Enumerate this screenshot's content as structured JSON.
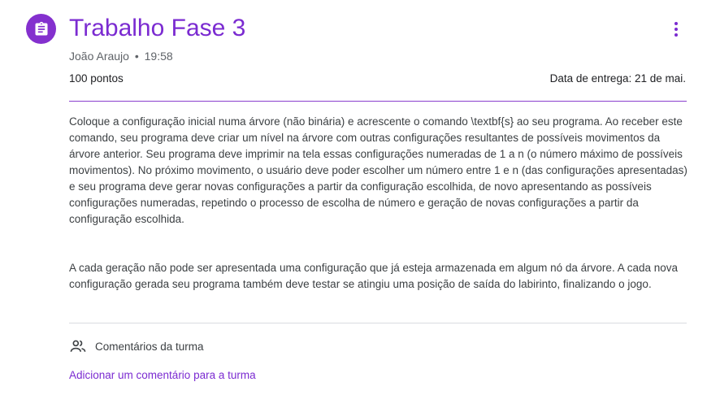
{
  "assignment": {
    "icon": "assignment-icon",
    "title": "Trabalho Fase 3",
    "author": "João Araujo",
    "separator": "•",
    "time": "19:58",
    "points": "100 pontos",
    "due": "Data de entrega: 21 de mai."
  },
  "description": {
    "paragraphs": [
      "Coloque a configuração inicial numa árvore (não binária) e acrescente o comando \\textbf{s} ao seu programa. Ao receber este comando, seu programa deve criar um nível na árvore com outras configurações resultantes de possíveis movimentos da árvore anterior. Seu programa deve imprimir na tela essas configurações numeradas de 1 a n (o número máximo de possíveis movimentos). No próximo movimento, o usuário deve poder escolher um número entre 1 e n (das configurações apresentadas) e seu programa deve gerar novas configurações a partir da configuração escolhida, de novo apresentando as possíveis configurações numeradas, repetindo o processo de escolha de número e geração de novas configurações a partir da configuração escolhida.",
      "A cada geração não pode ser apresentada uma configuração que já esteja armazenada em algum nó da árvore. A cada nova configuração gerada seu programa também deve testar se atingiu uma posição de saída do labirinto, finalizando o jogo."
    ]
  },
  "comments": {
    "icon": "people-icon",
    "header": "Comentários da turma",
    "add_label": "Adicionar um comentário para a turma"
  },
  "menu": {
    "icon": "more-vert-icon"
  },
  "colors": {
    "accent": "#7b2bd1",
    "icon_bg": "#8430ce"
  }
}
